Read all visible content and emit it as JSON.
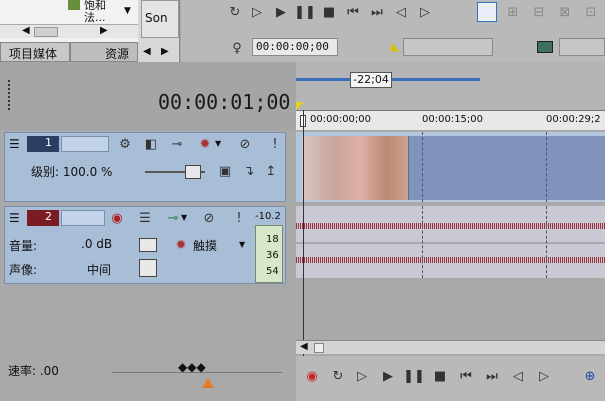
{
  "media_panel": {
    "tab_project_media": "项目媒体",
    "tab_resources_partial": "资源",
    "item1": "饱和",
    "item2": "法...",
    "son_label": "Son"
  },
  "transport_top": {
    "timecode": "00:00:00;00"
  },
  "timeline": {
    "current_time": "00:00:01;00",
    "length_marker": "-22;04",
    "ruler_labels": [
      "00:00:00;00",
      "00:00:15;00",
      "00:00:29;2"
    ]
  },
  "video_track": {
    "number": "1",
    "level_label": "级别: 100.0 %"
  },
  "audio_track": {
    "number": "2",
    "db_value": "-10.2",
    "meter_labels": [
      "18",
      "36",
      "54"
    ],
    "volume_label": "音量:",
    "volume_value": ".0 dB",
    "pan_label": "声像:",
    "pan_value": "中间",
    "touch_label": "触摸"
  },
  "status": {
    "rate_label": "速率: .00"
  },
  "colors": {
    "track_blue": "#a8bdd6",
    "wave_red": "#9b2f3b",
    "marker_yellow": "#e6d21a"
  }
}
